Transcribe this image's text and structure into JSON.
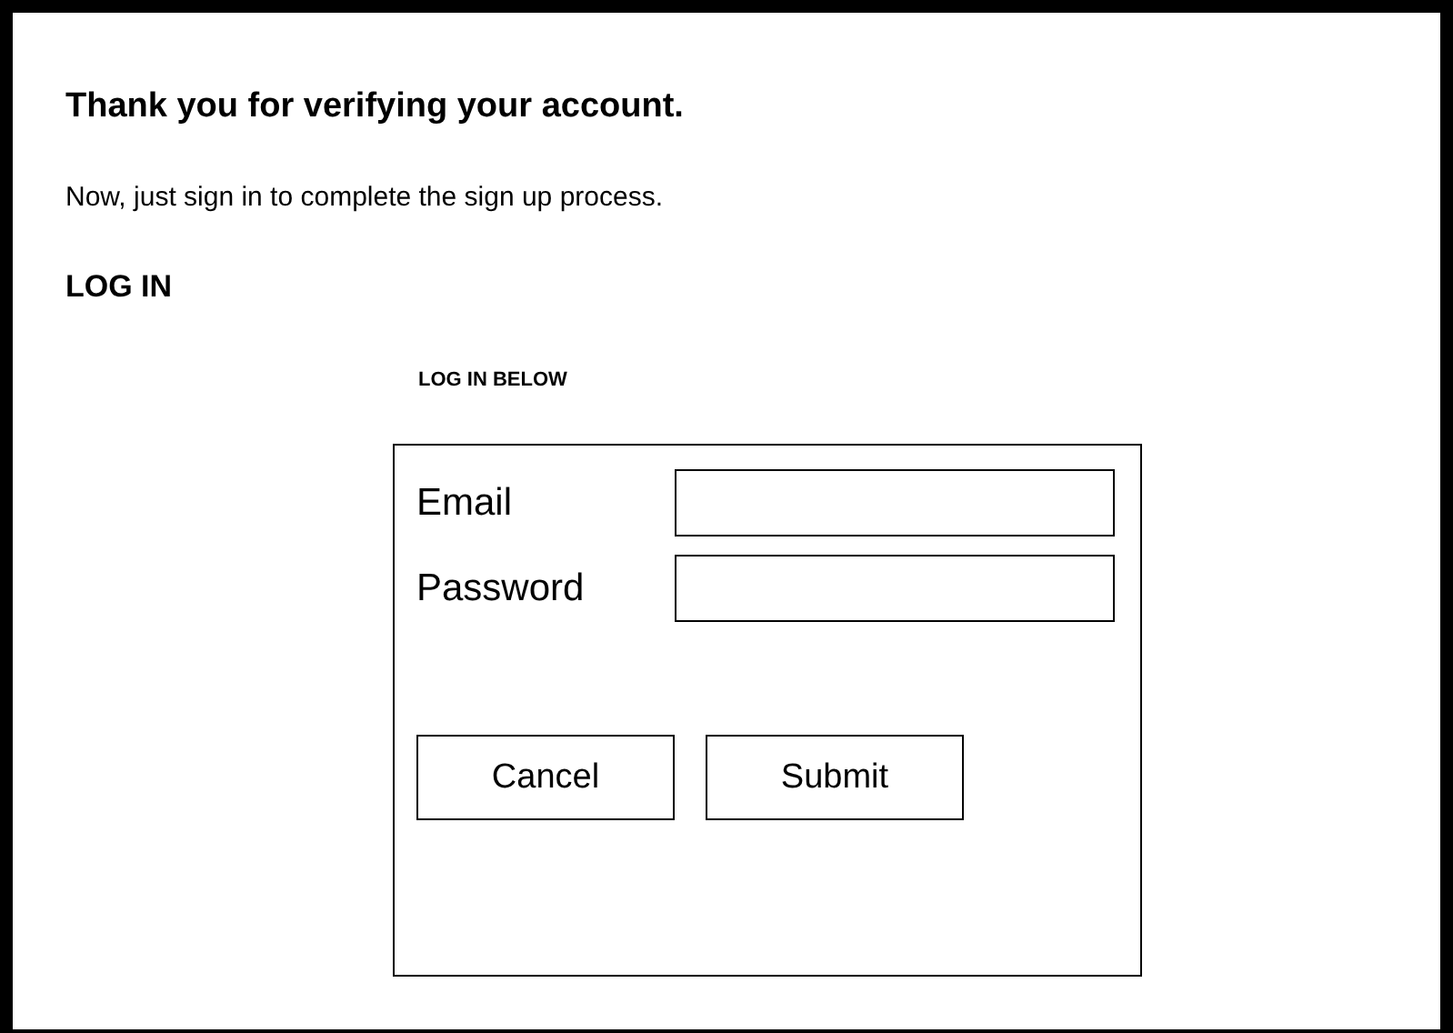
{
  "heading": "Thank you for verifying your account.",
  "message": "Now, just sign in to complete the sign up process.",
  "section_title": "LOG IN",
  "form_caption": "LOG IN BELOW",
  "fields": [
    {
      "label": "Email"
    },
    {
      "label": "Password"
    }
  ],
  "buttons": [
    "Cancel",
    "Submit"
  ]
}
